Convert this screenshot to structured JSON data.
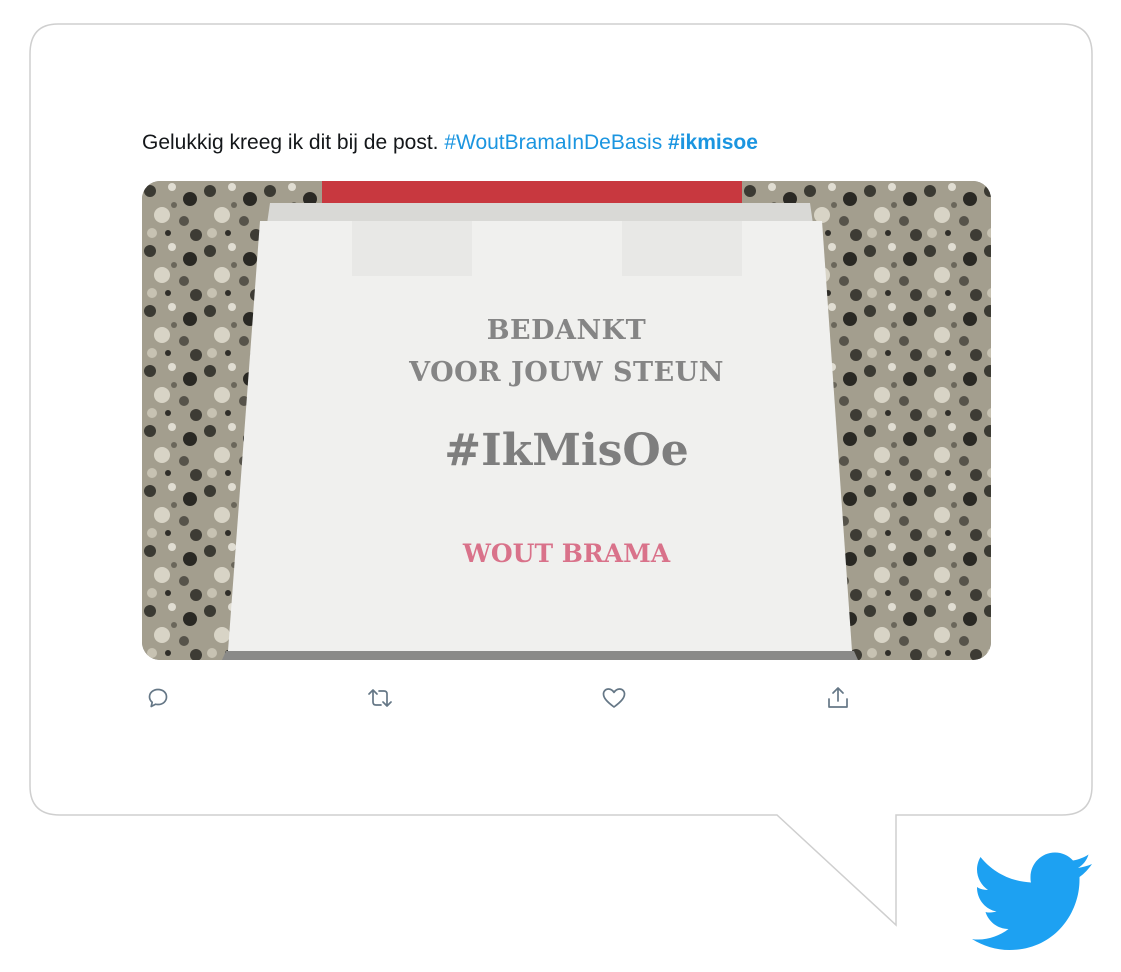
{
  "tweet": {
    "text": "Gelukkig kreeg ik dit bij de post.",
    "hashtag_1": "#WoutBramaInDeBasis",
    "hashtag_2": "#ikmisoe"
  },
  "media": {
    "line_1": "BEDANKT",
    "line_2": "VOOR JOUW STEUN",
    "line_3": "#IkMisOe",
    "line_4": "WOUT BRAMA"
  },
  "actions": [
    {
      "name": "reply",
      "icon": "reply-icon"
    },
    {
      "name": "retweet",
      "icon": "retweet-icon"
    },
    {
      "name": "like",
      "icon": "heart-icon"
    },
    {
      "name": "share",
      "icon": "share-icon"
    }
  ],
  "colors": {
    "hashtag": "#1b95e0",
    "bird": "#1da1f2",
    "bubble_border": "#cfcfcf",
    "icon": "#657786"
  }
}
